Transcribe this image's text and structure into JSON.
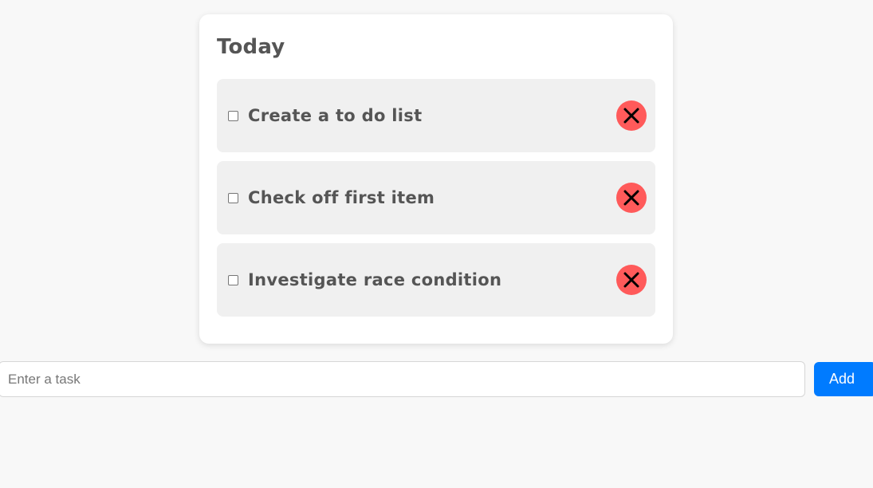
{
  "list": {
    "title": "Today",
    "tasks": [
      {
        "label": "Create a to do list",
        "checked": false
      },
      {
        "label": "Check off first item",
        "checked": false
      },
      {
        "label": "Investigate race condition",
        "checked": false
      }
    ],
    "delete_icon": "close-x-icon",
    "delete_color": "#ff5a5a"
  },
  "composer": {
    "placeholder": "Enter a task",
    "value": "",
    "add_label": "Add",
    "add_color": "#007bff"
  }
}
